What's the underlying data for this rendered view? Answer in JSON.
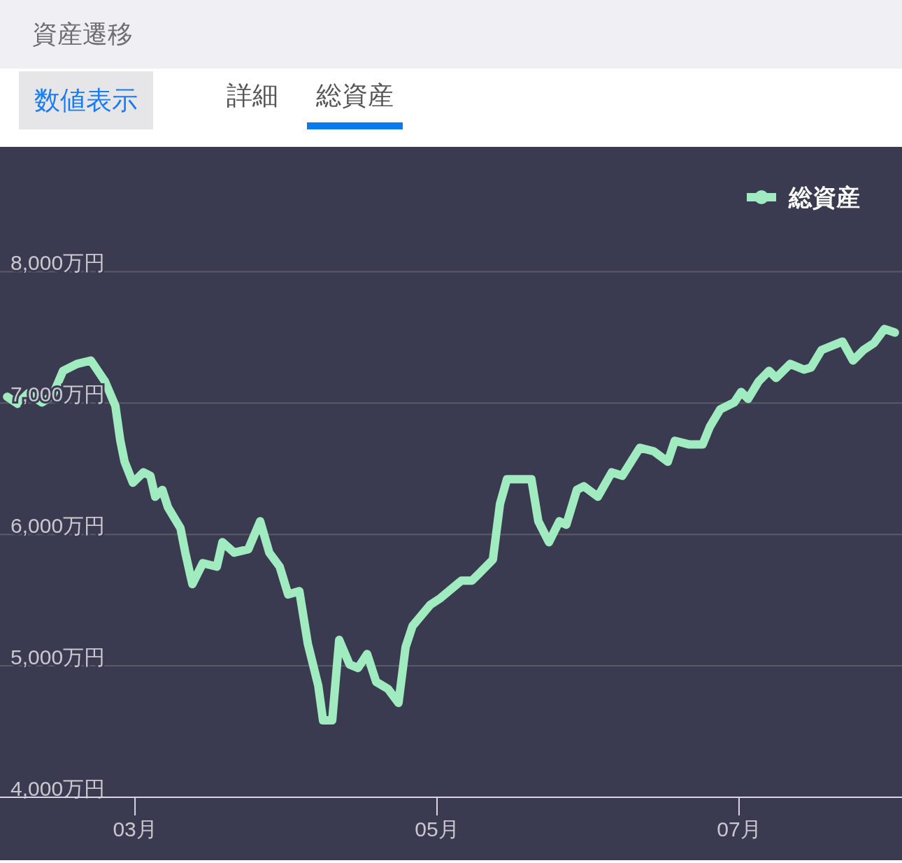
{
  "header": {
    "title": "資産遷移"
  },
  "toggle": {
    "label": "数値表示"
  },
  "tabs": [
    {
      "label": "詳細",
      "selected": false
    },
    {
      "label": "総資産",
      "selected": true
    }
  ],
  "chart_data": {
    "type": "line",
    "x": [
      2.153,
      2.222,
      2.292,
      2.384,
      2.454,
      2.523,
      2.616,
      2.708,
      2.801,
      2.87,
      2.903,
      2.931,
      2.986,
      3.056,
      3.102,
      3.134,
      3.181,
      3.218,
      3.301,
      3.333,
      3.38,
      3.449,
      3.542,
      3.579,
      3.657,
      3.75,
      3.829,
      3.889,
      3.958,
      4.014,
      4.088,
      4.144,
      4.213,
      4.245,
      4.306,
      4.352,
      4.421,
      4.477,
      4.537,
      4.597,
      4.676,
      4.745,
      4.792,
      4.838,
      4.954,
      5.023,
      5.162,
      5.231,
      5.278,
      5.37,
      5.417,
      5.463,
      5.625,
      5.671,
      5.741,
      5.81,
      5.856,
      5.926,
      5.972,
      6.065,
      6.157,
      6.227,
      6.343,
      6.435,
      6.528,
      6.574,
      6.667,
      6.759,
      6.806,
      6.875,
      6.968,
      7.014,
      7.06,
      7.13,
      7.199,
      7.245,
      7.338,
      7.43,
      7.477,
      7.546,
      7.685,
      7.755,
      7.824,
      7.894,
      7.963,
      8.032
    ],
    "series": [
      {
        "name": "総資産",
        "color": "#a0ebbf",
        "values": [
          7048,
          6995,
          7074,
          7005,
          7058,
          7245,
          7298,
          7324,
          7165,
          6979,
          6713,
          6553,
          6394,
          6473,
          6447,
          6287,
          6340,
          6207,
          6048,
          5862,
          5622,
          5782,
          5755,
          5941,
          5862,
          5888,
          6101,
          5862,
          5755,
          5543,
          5569,
          5170,
          4851,
          4585,
          4585,
          5197,
          5011,
          4984,
          5090,
          4878,
          4824,
          4718,
          5144,
          5303,
          5463,
          5516,
          5649,
          5649,
          5702,
          5809,
          6234,
          6420,
          6420,
          6101,
          5941,
          6101,
          6074,
          6340,
          6367,
          6287,
          6473,
          6447,
          6660,
          6633,
          6553,
          6713,
          6686,
          6686,
          6819,
          6952,
          7005,
          7085,
          7032,
          7165,
          7245,
          7191,
          7298,
          7255,
          7271,
          7404,
          7468,
          7324,
          7404,
          7457,
          7564,
          7537
        ]
      }
    ],
    "xlim": [
      2.106,
      8.079
    ],
    "ylim": [
      4000,
      8950
    ],
    "grid": true,
    "xticks": [
      {
        "value": 3,
        "label": "03月"
      },
      {
        "value": 5,
        "label": "05月"
      },
      {
        "value": 7,
        "label": "07月"
      }
    ],
    "yticks": [
      {
        "value": 4000,
        "label": "4,000万円"
      },
      {
        "value": 5000,
        "label": "5,000万円"
      },
      {
        "value": 6000,
        "label": "6,000万円"
      },
      {
        "value": 7000,
        "label": "7,000万円"
      },
      {
        "value": 8000,
        "label": "8,000万円"
      }
    ]
  }
}
